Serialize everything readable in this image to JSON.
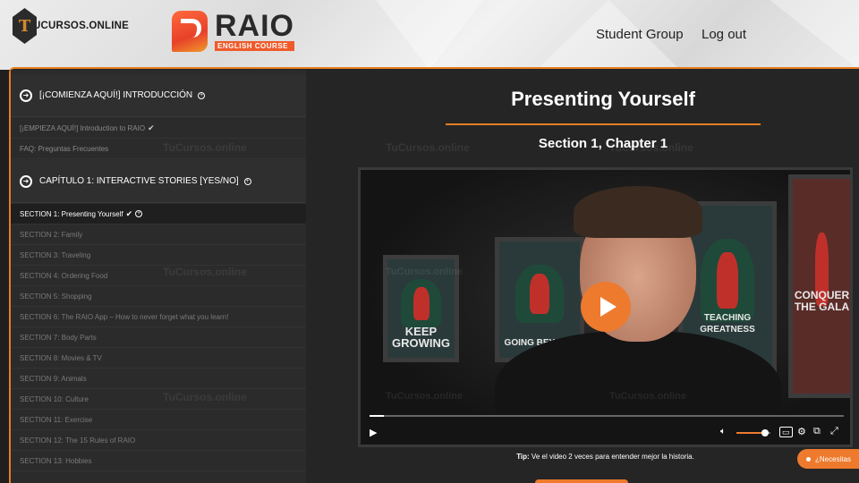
{
  "site": {
    "logo_letter": "T",
    "logo_text": "UCURSOS.ONLINE"
  },
  "brand": {
    "title": "RAIO",
    "subtitle": "ENGLISH COURSE",
    "accent": "#ee7a2e"
  },
  "nav": {
    "student_group": "Student Group",
    "logout": "Log out"
  },
  "sidebar": {
    "sections": [
      {
        "label": "[¡COMIENZA AQUÍ!] INTRODUCCIÓN"
      },
      {
        "label": "CAPÍTULO 1: INTERACTIVE STORIES [YES/NO]"
      }
    ],
    "intro_lessons": [
      {
        "label": "[¡EMPIEZA AQUÍ!] Introduction to RAIO",
        "completed": true
      },
      {
        "label": "FAQ: Preguntas Frecuentes",
        "completed": false
      }
    ],
    "chapter_lessons": [
      {
        "label": "SECTION 1: Presenting Yourself",
        "completed": true,
        "active": true
      },
      {
        "label": "SECTION 2: Family"
      },
      {
        "label": "SECTION 3: Traveling"
      },
      {
        "label": "SECTION 4: Ordering Food"
      },
      {
        "label": "SECTION 5: Shopping"
      },
      {
        "label": "SECTION 6: The RAIO App – How to never forget what you learn!"
      },
      {
        "label": "SECTION 7: Body Parts"
      },
      {
        "label": "SECTION 8: Movies & TV"
      },
      {
        "label": "SECTION 9: Animals"
      },
      {
        "label": "SECTION 10: Culture"
      },
      {
        "label": "SECTION 11: Exercise"
      },
      {
        "label": "SECTION 12: The 15 Rules of RAIO"
      },
      {
        "label": "SECTION 13: Hobbies"
      }
    ]
  },
  "main": {
    "title": "Presenting Yourself",
    "subtitle": "Section 1, Chapter 1",
    "tip_label": "Tip:",
    "tip_text": " Ve el video 2 veces para entender mejor la historia."
  },
  "video": {
    "poster_left_text": "KEEP GROWING",
    "poster_center_text": "GOING BEYOND",
    "poster_right_mid_text": "TEACHING GREATNESS",
    "poster_right_text": "CONQUER THE GALA",
    "progress": 0.03,
    "volume": 0.85
  },
  "watermark": "TuCursos.online",
  "help": {
    "label": "¿Necesitas"
  }
}
